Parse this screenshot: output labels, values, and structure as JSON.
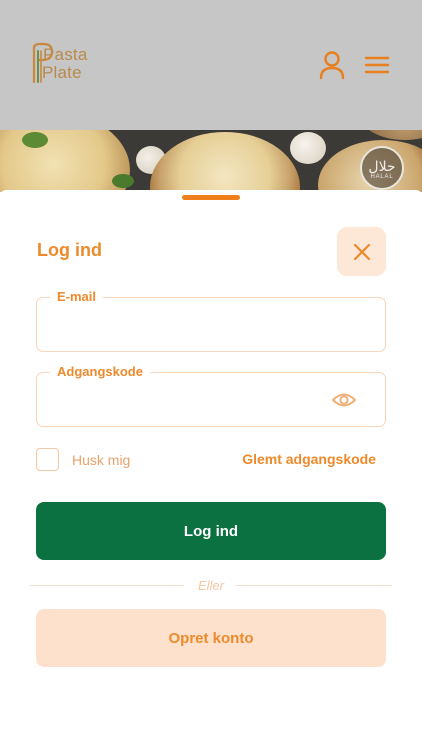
{
  "header": {
    "logo": {
      "line1": "Pasta",
      "line2": "Plate"
    },
    "user_icon": "user-icon",
    "menu_icon": "hamburger-menu-icon"
  },
  "hero": {
    "badge_glyph": "حلال",
    "badge_text": "HALAL"
  },
  "login_sheet": {
    "title": "Log ind",
    "close_icon": "close-icon",
    "email": {
      "label": "E-mail",
      "value": "",
      "placeholder": ""
    },
    "password": {
      "label": "Adgangskode",
      "value": "",
      "placeholder": "",
      "toggle_icon": "eye-icon"
    },
    "remember_me": {
      "label": "Husk mig",
      "checked": false
    },
    "forgot_password": "Glemt adgangskode",
    "login_button": "Log ind",
    "divider_text": "Eller",
    "signup_button": "Opret konto"
  },
  "colors": {
    "accent_orange": "#ec8a2c",
    "primary_green": "#0b7140",
    "soft_peach": "#fde1cc",
    "overlay_gray": "#c6c6c6"
  }
}
